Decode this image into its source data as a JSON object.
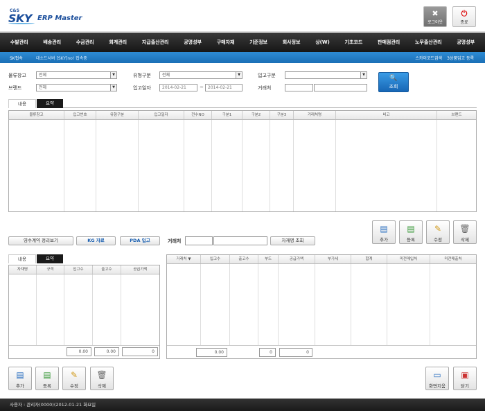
{
  "brand": {
    "cs": "C&S",
    "sky": "SKY",
    "title": "ERP Master"
  },
  "header_buttons": {
    "logout": "로그아웃",
    "exit": "종료"
  },
  "menu": [
    "수발관리",
    "배송관리",
    "수금관리",
    "회계관리",
    "지급출산관리",
    "공명성부",
    "구매자재",
    "기준정보",
    "회사정보",
    "상(W)",
    "기초코드",
    "판매점관리",
    "노무출산관리",
    "공명성부"
  ],
  "subbar": {
    "left1": "SK접속",
    "left2": "대소드서버 [SKY]no! 접속중",
    "right1": "스카이코드검색",
    "right2": "3상품입고 등록"
  },
  "filters": {
    "label_warehouse": "물류창고",
    "warehouse": "전체",
    "label_type": "유형구분",
    "type": "전체",
    "label_in_kind": "입고구분",
    "in_kind": "",
    "label_brand": "브랜드",
    "brand": "전체",
    "label_date": "입고일자",
    "date_from": "2014-02-21",
    "date_sep": "~",
    "date_to": "2014-02-21",
    "label_vendor": "거래처",
    "vendor_code": "",
    "vendor_name": "",
    "search": "조회"
  },
  "top_tabs": [
    "내용",
    "요약"
  ],
  "top_grid_cols": [
    "물류창고",
    "입고번호",
    "유형구분",
    "입고일자",
    "전수NO",
    "구분1",
    "구분2",
    "구분3",
    "거래처명",
    "비고",
    "브랜드"
  ],
  "top_actions": [
    "추가",
    "등록",
    "수정",
    "삭제"
  ],
  "mid_buttons": {
    "history": "영수계약 정리보기",
    "kg": "KG 자료",
    "pda": "PDA 입고",
    "label_vendor": "거래처",
    "vendor_code": "",
    "vendor_name": "",
    "vendor_search": "자재명 조회"
  },
  "bottom_left_tabs": [
    "내용",
    "요약"
  ],
  "bottom_left_cols": [
    "자재명",
    "규격",
    "입고수",
    "출고수",
    "공급가액"
  ],
  "bottom_left_sums": [
    "0.00",
    "0.00",
    "0"
  ],
  "bottom_right_cols": [
    "거래처",
    "입고수",
    "출고수",
    "부드",
    "공급가액",
    "부가세",
    "합계",
    "미전매입처",
    "미전매출처"
  ],
  "bottom_right_sums": [
    "0.00",
    "0",
    "0"
  ],
  "bottom_actions": [
    "추가",
    "등록",
    "수정",
    "삭제"
  ],
  "bottom_right_actions": [
    "화면지움",
    "닫기"
  ],
  "footer": "사용자 : 관리자(0000)(2012-01-21 화요일"
}
